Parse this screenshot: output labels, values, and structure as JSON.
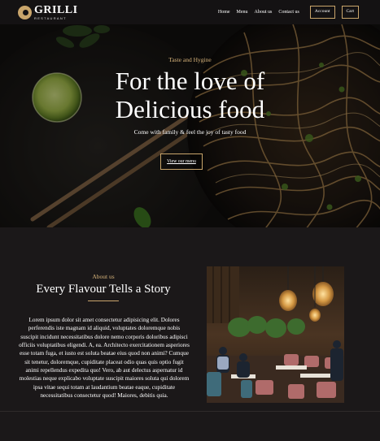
{
  "header": {
    "logo_name": "GRILLI",
    "logo_sub": "RESTAURANT",
    "nav": [
      "Home",
      "Menu",
      "About us",
      "Contact us"
    ],
    "account_label": "Account",
    "cart_label": "Cart"
  },
  "hero": {
    "eyebrow": "Taste and Hygine",
    "title_line1": "For the love of",
    "title_line2": "Delicious food",
    "subtitle": "Come with family & feel the joy of tasty food",
    "button_label": "View our menu"
  },
  "about": {
    "eyebrow": "About us",
    "title": "Every Flavour Tells a Story",
    "body": "Lorem ipsum dolor sit amet consectetur adipisicing elit. Dolores perferendis iste magnam id aliquid, voluptates doloremque nobis suscipit incidunt necessitatibus dolore nemo corporis doloribus adipisci officiis voluptatibus eligendi. A, ea. Architecto exercitationem asperiores esse totam fuga, et iusto est soluta beatae eius quod non animi? Cumque sit tenetur, doloremque, cupiditate placeat odio quas quis optio fugit animi repellendus expedita quo! Vero, ab aut delectus aspernatur id molestias neque explicabo voluptate suscipit maiores soluta qui dolorem ipsa vitae sequi totam at laudantium beatae eaque, cupiditate necessitatibus consectetur quod! Maiores, debitis quia."
  },
  "colors": {
    "accent_gold": "#c9a56b",
    "background": "#181516"
  }
}
